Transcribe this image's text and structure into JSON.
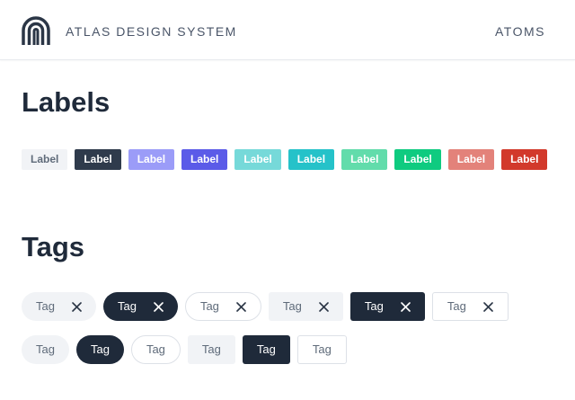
{
  "header": {
    "brand": "ATLAS DESIGN SYSTEM",
    "section": "ATOMS"
  },
  "labels_section": {
    "title": "Labels",
    "labels": [
      {
        "text": "Label",
        "bg": "#f1f3f6",
        "fg": "#5f6b7a"
      },
      {
        "text": "Label",
        "bg": "#2f3b4c",
        "fg": "#ffffff"
      },
      {
        "text": "Label",
        "bg": "#9b9cf8",
        "fg": "#ffffff"
      },
      {
        "text": "Label",
        "bg": "#5b5be8",
        "fg": "#ffffff"
      },
      {
        "text": "Label",
        "bg": "#76d9d9",
        "fg": "#ffffff"
      },
      {
        "text": "Label",
        "bg": "#25c2c9",
        "fg": "#ffffff"
      },
      {
        "text": "Label",
        "bg": "#62dcab",
        "fg": "#ffffff"
      },
      {
        "text": "Label",
        "bg": "#0fcb80",
        "fg": "#ffffff"
      },
      {
        "text": "Label",
        "bg": "#e3827a",
        "fg": "#ffffff"
      },
      {
        "text": "Label",
        "bg": "#d2392b",
        "fg": "#ffffff"
      }
    ]
  },
  "tags_section": {
    "title": "Tags",
    "removable": [
      {
        "text": "Tag",
        "style": "light",
        "shape": "pill"
      },
      {
        "text": "Tag",
        "style": "dark",
        "shape": "pill"
      },
      {
        "text": "Tag",
        "style": "outline",
        "shape": "pill"
      },
      {
        "text": "Tag",
        "style": "light",
        "shape": "square"
      },
      {
        "text": "Tag",
        "style": "dark",
        "shape": "square"
      },
      {
        "text": "Tag",
        "style": "outline",
        "shape": "square"
      }
    ],
    "plain": [
      {
        "text": "Tag",
        "style": "light",
        "shape": "pill"
      },
      {
        "text": "Tag",
        "style": "dark",
        "shape": "pill"
      },
      {
        "text": "Tag",
        "style": "outline",
        "shape": "pill"
      },
      {
        "text": "Tag",
        "style": "light",
        "shape": "square"
      },
      {
        "text": "Tag",
        "style": "dark",
        "shape": "square"
      },
      {
        "text": "Tag",
        "style": "outline",
        "shape": "square"
      }
    ],
    "remove_icon": "close-icon"
  }
}
